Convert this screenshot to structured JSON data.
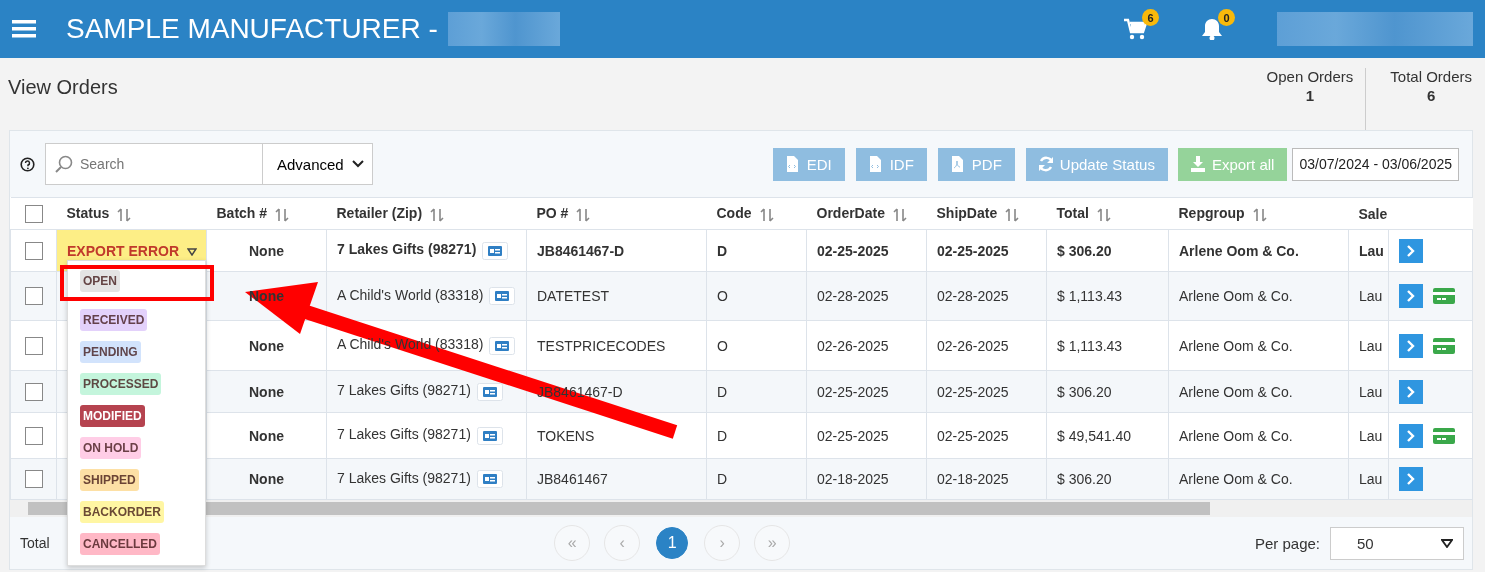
{
  "header": {
    "title": "SAMPLE MANUFACTURER -",
    "cart_count": "6",
    "notification_count": "0"
  },
  "page": {
    "title": "View Orders"
  },
  "stats": [
    {
      "label": "Open Orders",
      "value": "1"
    },
    {
      "label": "Total Orders",
      "value": "6"
    }
  ],
  "toolbar": {
    "search": {
      "placeholder": "Search"
    },
    "advanced": "Advanced",
    "buttons": [
      {
        "label": "EDI",
        "kind": "file"
      },
      {
        "label": "IDF",
        "kind": "file"
      },
      {
        "label": "PDF",
        "kind": "pdf"
      },
      {
        "label": "Update Status",
        "kind": "refresh"
      },
      {
        "label": "Export all",
        "kind": "download"
      }
    ],
    "date_range": "03/07/2024 - 03/06/2025"
  },
  "table": {
    "select_all_checked": false,
    "columns": [
      "Status",
      "Batch #",
      "Retailer (Zip)",
      "PO #",
      "Code",
      "OrderDate",
      "ShipDate",
      "Total",
      "Repgroup",
      "Sale"
    ],
    "rows": [
      {
        "checked": false,
        "bold": true,
        "status": "EXPORT ERROR",
        "batch": "None",
        "retailer": "7 Lakes Gifts (98271)",
        "po": "JB8461467-D",
        "code": "D",
        "order_date": "02-25-2025",
        "ship_date": "02-25-2025",
        "total": "$ 306.20",
        "repgroup": "Arlene Oom & Co.",
        "column_10": "Lau",
        "card": false
      },
      {
        "checked": false,
        "bold": false,
        "batch": "None",
        "retailer": "A Child's World (83318)",
        "po": "DATETEST",
        "code": "O",
        "order_date": "02-28-2025",
        "ship_date": "02-28-2025",
        "total": "$ 1,113.43",
        "repgroup": "Arlene Oom & Co.",
        "column_10": "Lau",
        "card": true
      },
      {
        "checked": false,
        "bold": false,
        "batch": "None",
        "retailer": "A Child's World (83318)",
        "po": "TESTPRICECODES",
        "code": "O",
        "order_date": "02-26-2025",
        "ship_date": "02-26-2025",
        "total": "$ 1,113.43",
        "repgroup": "Arlene Oom & Co.",
        "column_10": "Lau",
        "card": true
      },
      {
        "checked": false,
        "bold": false,
        "batch": "None",
        "retailer": "7 Lakes Gifts (98271)",
        "po": "JB8461467-D",
        "code": "D",
        "order_date": "02-25-2025",
        "ship_date": "02-25-2025",
        "total": "$ 306.20",
        "repgroup": "Arlene Oom & Co.",
        "column_10": "Lau",
        "card": false
      },
      {
        "checked": false,
        "bold": false,
        "batch": "None",
        "retailer": "7 Lakes Gifts (98271)",
        "po": "TOKENS",
        "code": "D",
        "order_date": "02-25-2025",
        "ship_date": "02-25-2025",
        "total": "$ 49,541.40",
        "repgroup": "Arlene Oom & Co.",
        "column_10": "Lau",
        "card": true
      },
      {
        "checked": false,
        "bold": false,
        "batch": "None",
        "retailer": "7 Lakes Gifts (98271)",
        "po": "JB8461467",
        "code": "D",
        "order_date": "02-18-2025",
        "ship_date": "02-18-2025",
        "total": "$ 306.20",
        "repgroup": "Arlene Oom & Co.",
        "column_10": "Lau",
        "card": false
      }
    ]
  },
  "status_menu": [
    {
      "label": "OPEN",
      "color": "#e4e4e4",
      "selected": true
    },
    {
      "label": "RECEIVED",
      "color": "#e3d1fb",
      "selected": false
    },
    {
      "label": "PENDING",
      "color": "#d2e3fc",
      "selected": false
    },
    {
      "label": "PROCESSED",
      "color": "#c4f5dc",
      "selected": false
    },
    {
      "label": "MODIFIED",
      "color": "#b5434f",
      "selected": false
    },
    {
      "label": "ON HOLD",
      "color": "#ffcde6",
      "selected": false
    },
    {
      "label": "SHIPPED",
      "color": "#fde0a5",
      "selected": false
    },
    {
      "label": "BACKORDER",
      "color": "#fff6a3",
      "selected": false
    },
    {
      "label": "CANCELLED",
      "color": "#ffb8c6",
      "selected": false
    }
  ],
  "footer": {
    "total_label": "Total",
    "pages": [
      {
        "label": "«",
        "selected": false
      },
      {
        "label": "‹",
        "selected": false
      },
      {
        "label": "1",
        "selected": true
      },
      {
        "label": "›",
        "selected": false
      },
      {
        "label": "»",
        "selected": false
      }
    ],
    "per_page_label": "Per page:",
    "per_page": "50"
  }
}
